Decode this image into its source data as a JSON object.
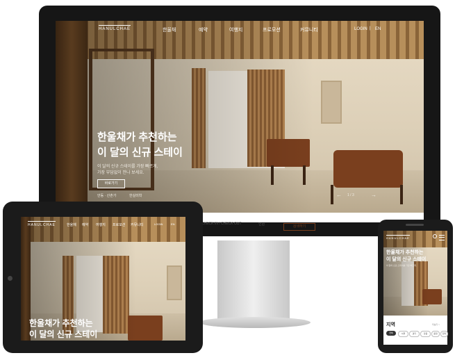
{
  "brand": {
    "logo_text": "HANULCHAE"
  },
  "nav": {
    "items": [
      "한울채",
      "예약",
      "여행지",
      "프로모션",
      "커뮤니티"
    ],
    "login": "LOGIN",
    "divider": "|",
    "lang": "EN"
  },
  "hero": {
    "title_line1": "한울채가 추천하는",
    "title_line2": "이 달의 신규 스테이",
    "subtitle_line1": "이 달의 신규 스테이를 가장 빠르게,",
    "subtitle_line2": "가장 부담없이 만나 보세요.",
    "cta": "바로가기",
    "pager": "1 / 3",
    "left_caption": "안동 · 산촌가",
    "right_caption": "한실미학"
  },
  "booking_bar": {
    "checkin_label": "CHECK IN / CHECK OUT",
    "guests_label": "인원",
    "search_button": "검색하기"
  },
  "tablet": {
    "logo_text": "HANULCHAE",
    "nav_items": [
      "한울채",
      "예약",
      "여행지",
      "프로모션",
      "커뮤니티"
    ],
    "login": "LOGIN",
    "lang": "EN",
    "title_line1": "한울채가 추천하는",
    "title_line2": "이 달의 신규 스테이"
  },
  "phone": {
    "logo_text": "HANULCHAE",
    "title_line1": "한울채가 추천하는",
    "title_line2": "이 달의 신규 스테이",
    "subtitle": "이 달의 신규 스테이를 가장 빠르게,",
    "section_title": "지역",
    "section_more": "더보기 >",
    "chips": [
      "전체",
      "서울",
      "경기",
      "강원",
      "충청",
      "전라"
    ]
  },
  "colors": {
    "accent": "#7a3f1e",
    "wood": "#b48451",
    "bezel": "#161616"
  }
}
